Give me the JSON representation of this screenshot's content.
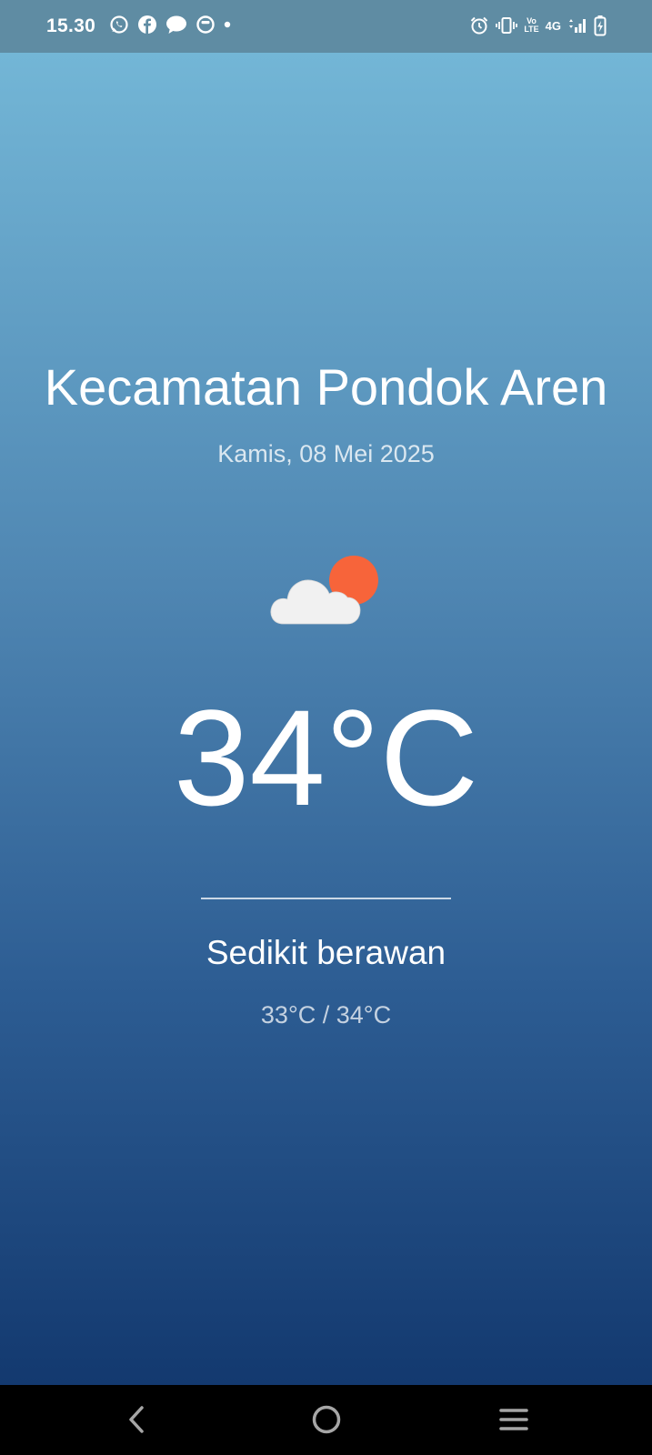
{
  "status_bar": {
    "time": "15.30",
    "left_icons": [
      "whatsapp-icon",
      "facebook-icon",
      "chat-bubble-icon",
      "app-notification-icon",
      "more-notifications-dot-icon"
    ],
    "right_icons": [
      "alarm-icon",
      "vibrate-icon",
      "volte-icon",
      "network-4g-icon",
      "signal-icon",
      "battery-charging-icon"
    ],
    "volte_line1": "Vo",
    "volte_line2": "LTE",
    "network_label": "4G"
  },
  "weather": {
    "location": "Kecamatan Pondok Aren",
    "date": "Kamis, 08 Mei 2025",
    "icon": "partly-cloudy-icon",
    "temperature": "34°C",
    "condition": "Sedikit berawan",
    "min_max": "33°C / 34°C"
  },
  "nav_bar": {
    "buttons": [
      "back-icon",
      "home-icon",
      "recents-icon"
    ]
  },
  "colors": {
    "status_bar_bg": "#5f8ca3",
    "gradient_top": "#73b6d6",
    "gradient_bottom": "#13396f",
    "sun": "#f7643a",
    "cloud": "#f1f1f1"
  }
}
